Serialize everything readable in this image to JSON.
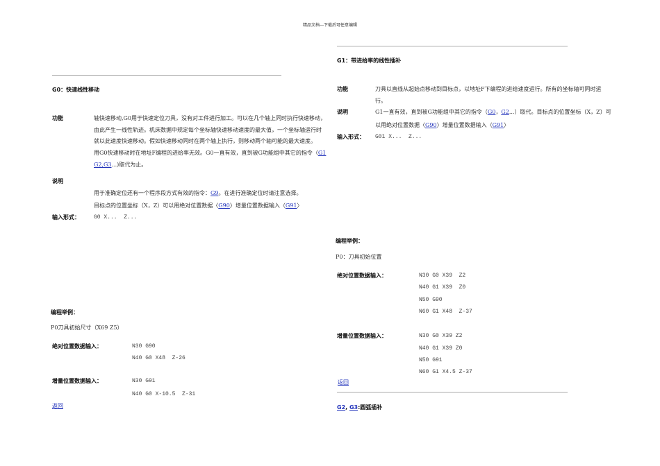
{
  "header": "精品文档---下载后可任意编辑",
  "g0": {
    "title": "G0：快速线性移动",
    "func_label": "功能",
    "func_lines": [
      "轴快速移动,G0用于快速定位刀具，没有对工件进行加工。可以在几个轴上同时执行快速移动，",
      "由此产生一线性轨迹。机床数据中规定每个坐标轴快速移动速度的最大值，一个坐标轴运行时",
      "就以此速度快速移动。假如快速移动同时在两个轴上执行，则移动两个轴可能的最大速度。"
    ],
    "func_line4": "用G0快速移动时在地址F编程的进给率无效。G0一直有效，直到被G功能组中其它的指令（",
    "link_g1": "G1",
    "link_g2g3": "G2,G3",
    "func_line5_tail": "...)取代为止。",
    "note_label": "说明",
    "note1_pre": "用于准确定位还有一个程序段方式有效的指令：",
    "link_g9": "G9",
    "note1_post": "。在进行准确定位时请注意选择。",
    "note2_pre": "目标点的位置坐标（X，Z）可以用绝对位置数据〈",
    "link_g90": "G90",
    "note2_mid": "〉增量位置数据输入〈",
    "link_g91": "G91",
    "note2_post": "〉",
    "input_label": "输入形式：",
    "input_value": "G0 X...  Z...",
    "example_label": "编程举例：",
    "p0": "P0刀具初始尺寸（X69  Z5）",
    "abs_label": "绝对位置数据输入：",
    "abs_code": [
      "N30 G90",
      "N40 G0 X48  Z-26"
    ],
    "inc_label": "增量位置数据输入：",
    "inc_code": [
      "N30 G91",
      "N40 G0 X-10.5  Z-31"
    ],
    "back": "返回"
  },
  "g1": {
    "title": "G1：带进给率的线性插补",
    "func_label": "功能",
    "func_lines": [
      "刀具以直线从起始点移动到目标点，以地址F下编程的进给速度运行。所有的坐标轴可同时运",
      "行。"
    ],
    "note_label": "说明",
    "note1_pre": "G1一直有效，直到被G功能组中其它的指令（",
    "link_g0": "G0",
    "sep": "，",
    "link_g2": "G2",
    "note1_post": "...）取代。目标点的位置坐标（X，Z）可",
    "note2_pre": "以用绝对位置数据〈",
    "link_g90": "G90",
    "note2_mid": "〉增量位置数据输入〈",
    "link_g91": "G91",
    "note2_post": "〉",
    "input_label": "输入形式：",
    "input_value": "G01 X...  Z...",
    "example_label": "编程举例：",
    "p0": "P0：刀具初始位置",
    "abs_label": "绝对位置数据输入：",
    "abs_code": [
      "N30 G0 X39  Z2",
      "N40 G1 X39  Z0",
      "N50 G90",
      "N60 G1 X48  Z-37"
    ],
    "inc_label": "增量位置数据输入：",
    "inc_code": [
      "N30 G0 X39 Z2",
      "N40 G1 X39 Z0",
      "N50 G91",
      "N60 G1 X4.5 Z-37"
    ],
    "back": "返回"
  },
  "g2g3": {
    "link_g2": "G2",
    "sep": ", ",
    "link_g3": "G3",
    "title": ":圆弧插补"
  }
}
